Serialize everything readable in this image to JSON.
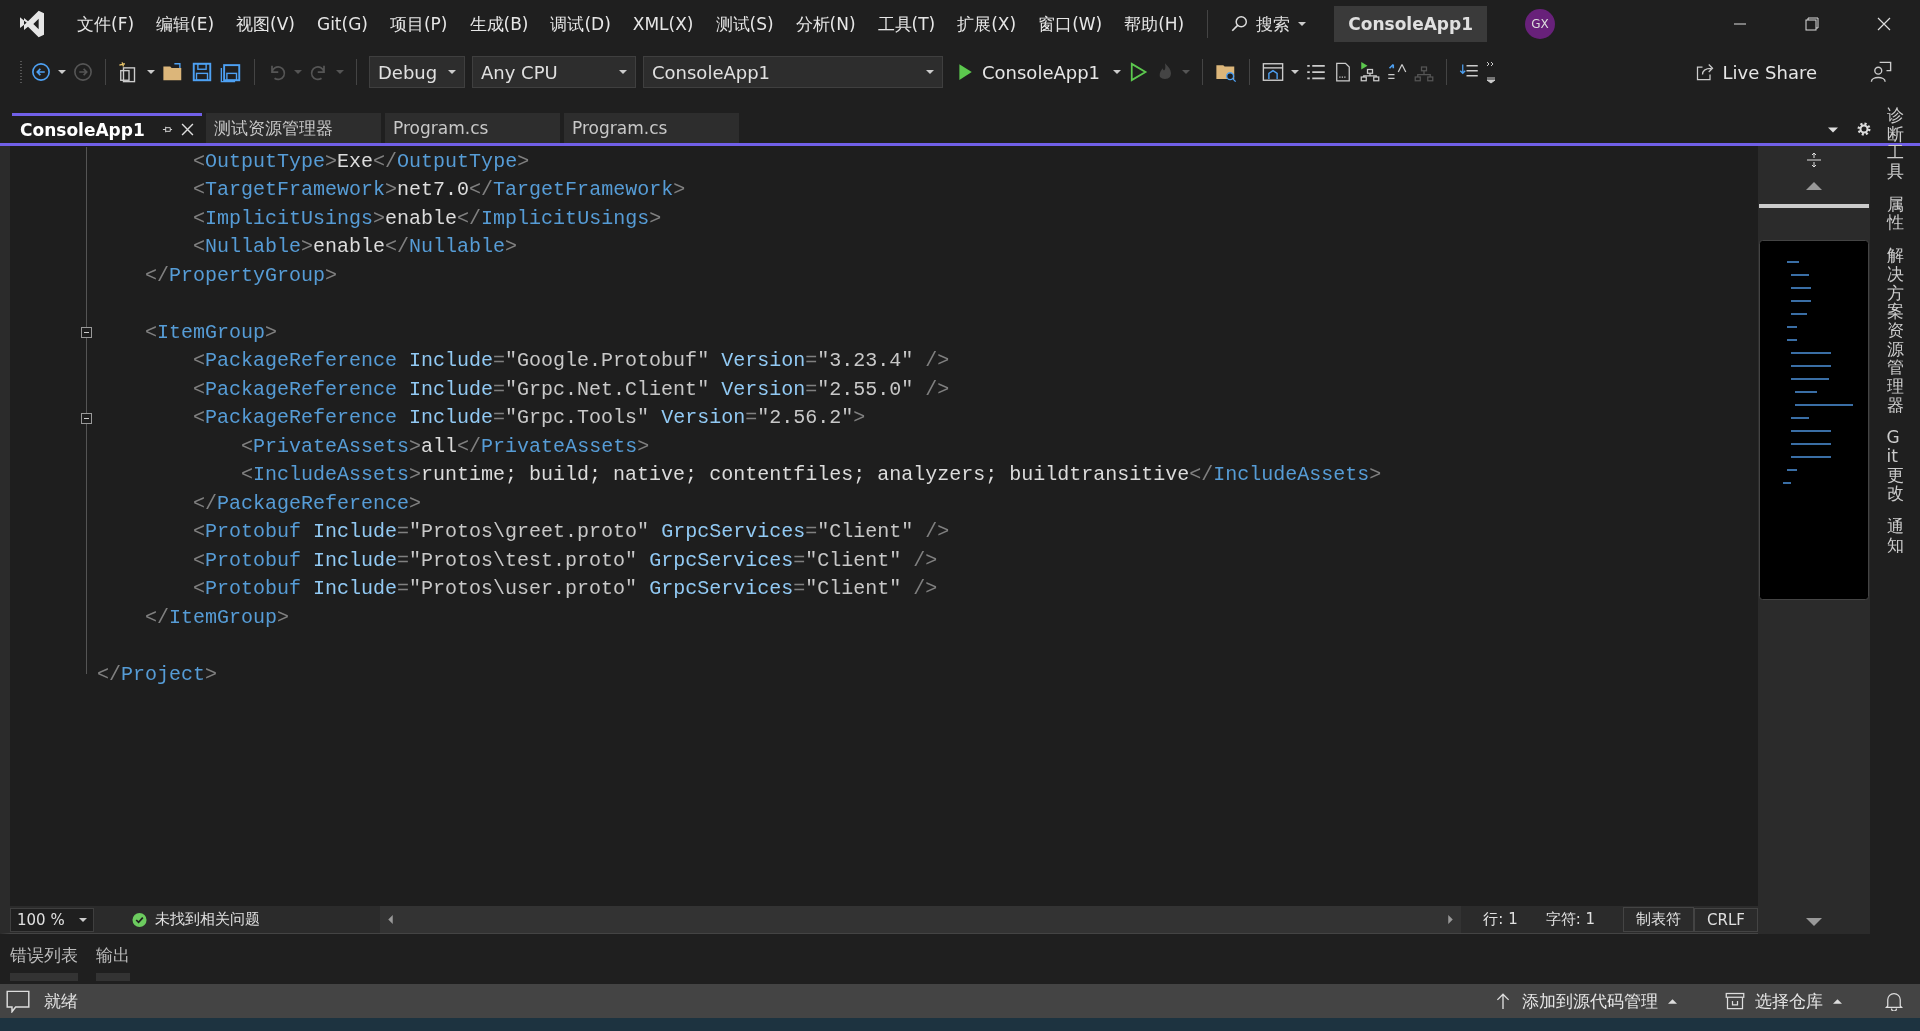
{
  "menu": [
    "文件(F)",
    "编辑(E)",
    "视图(V)",
    "Git(G)",
    "项目(P)",
    "生成(B)",
    "调试(D)",
    "XML(X)",
    "测试(S)",
    "分析(N)",
    "工具(T)",
    "扩展(X)",
    "窗口(W)",
    "帮助(H)"
  ],
  "search": {
    "label": "搜索"
  },
  "window": {
    "title": "ConsoleApp1",
    "avatar": "GX"
  },
  "toolbar": {
    "configuration": "Debug",
    "platform": "Any CPU",
    "project": "ConsoleApp1",
    "run_target": "ConsoleApp1",
    "live_share": "Live Share"
  },
  "tabs": [
    {
      "label": "ConsoleApp1",
      "selected": true
    },
    {
      "label": "测试资源管理器",
      "selected": false
    },
    {
      "label": "Program.cs",
      "selected": false
    },
    {
      "label": "Program.cs",
      "selected": false
    }
  ],
  "code_lines": [
    {
      "kind": "code",
      "collapsible": false,
      "tokens": [
        {
          "kind": "delim",
          "text": "        <"
        },
        {
          "kind": "name",
          "text": "OutputType"
        },
        {
          "kind": "delim",
          "text": ">"
        },
        {
          "kind": "text",
          "text": "Exe"
        },
        {
          "kind": "delim",
          "text": "</"
        },
        {
          "kind": "name",
          "text": "OutputType"
        },
        {
          "kind": "delim",
          "text": ">"
        }
      ]
    },
    {
      "kind": "code",
      "collapsible": false,
      "tokens": [
        {
          "kind": "delim",
          "text": "        <"
        },
        {
          "kind": "name",
          "text": "TargetFramework"
        },
        {
          "kind": "delim",
          "text": ">"
        },
        {
          "kind": "text",
          "text": "net7.0"
        },
        {
          "kind": "delim",
          "text": "</"
        },
        {
          "kind": "name",
          "text": "TargetFramework"
        },
        {
          "kind": "delim",
          "text": ">"
        }
      ]
    },
    {
      "kind": "code",
      "collapsible": false,
      "tokens": [
        {
          "kind": "delim",
          "text": "        <"
        },
        {
          "kind": "name",
          "text": "ImplicitUsings"
        },
        {
          "kind": "delim",
          "text": ">"
        },
        {
          "kind": "text",
          "text": "enable"
        },
        {
          "kind": "delim",
          "text": "</"
        },
        {
          "kind": "name",
          "text": "ImplicitUsings"
        },
        {
          "kind": "delim",
          "text": ">"
        }
      ]
    },
    {
      "kind": "code",
      "collapsible": false,
      "tokens": [
        {
          "kind": "delim",
          "text": "        <"
        },
        {
          "kind": "name",
          "text": "Nullable"
        },
        {
          "kind": "delim",
          "text": ">"
        },
        {
          "kind": "text",
          "text": "enable"
        },
        {
          "kind": "delim",
          "text": "</"
        },
        {
          "kind": "name",
          "text": "Nullable"
        },
        {
          "kind": "delim",
          "text": ">"
        }
      ]
    },
    {
      "kind": "code",
      "collapsible": false,
      "tokens": [
        {
          "kind": "delim",
          "text": "    </"
        },
        {
          "kind": "name",
          "text": "PropertyGroup"
        },
        {
          "kind": "delim",
          "text": ">"
        }
      ]
    },
    {
      "kind": "blank",
      "collapsible": false
    },
    {
      "kind": "code",
      "collapsible": true,
      "tokens": [
        {
          "kind": "delim",
          "text": "    <"
        },
        {
          "kind": "name",
          "text": "ItemGroup"
        },
        {
          "kind": "delim",
          "text": ">"
        }
      ]
    },
    {
      "kind": "code",
      "collapsible": false,
      "tokens": [
        {
          "kind": "delim",
          "text": "        <"
        },
        {
          "kind": "name",
          "text": "PackageReference"
        },
        {
          "kind": "attr",
          "text": " Include"
        },
        {
          "kind": "delim",
          "text": "="
        },
        {
          "kind": "value",
          "text": "\"Google.Protobuf\""
        },
        {
          "kind": "attr",
          "text": " Version"
        },
        {
          "kind": "delim",
          "text": "="
        },
        {
          "kind": "value",
          "text": "\"3.23.4\""
        },
        {
          "kind": "delim",
          "text": " />"
        }
      ]
    },
    {
      "kind": "code",
      "collapsible": false,
      "tokens": [
        {
          "kind": "delim",
          "text": "        <"
        },
        {
          "kind": "name",
          "text": "PackageReference"
        },
        {
          "kind": "attr",
          "text": " Include"
        },
        {
          "kind": "delim",
          "text": "="
        },
        {
          "kind": "value",
          "text": "\"Grpc.Net.Client\""
        },
        {
          "kind": "attr",
          "text": " Version"
        },
        {
          "kind": "delim",
          "text": "="
        },
        {
          "kind": "value",
          "text": "\"2.55.0\""
        },
        {
          "kind": "delim",
          "text": " />"
        }
      ]
    },
    {
      "kind": "code",
      "collapsible": true,
      "tokens": [
        {
          "kind": "delim",
          "text": "        <"
        },
        {
          "kind": "name",
          "text": "PackageReference"
        },
        {
          "kind": "attr",
          "text": " Include"
        },
        {
          "kind": "delim",
          "text": "="
        },
        {
          "kind": "value",
          "text": "\"Grpc.Tools\""
        },
        {
          "kind": "attr",
          "text": " Version"
        },
        {
          "kind": "delim",
          "text": "="
        },
        {
          "kind": "value",
          "text": "\"2.56.2\""
        },
        {
          "kind": "delim",
          "text": ">"
        }
      ]
    },
    {
      "kind": "code",
      "collapsible": false,
      "tokens": [
        {
          "kind": "delim",
          "text": "            <"
        },
        {
          "kind": "name",
          "text": "PrivateAssets"
        },
        {
          "kind": "delim",
          "text": ">"
        },
        {
          "kind": "text",
          "text": "all"
        },
        {
          "kind": "delim",
          "text": "</"
        },
        {
          "kind": "name",
          "text": "PrivateAssets"
        },
        {
          "kind": "delim",
          "text": ">"
        }
      ]
    },
    {
      "kind": "code",
      "collapsible": false,
      "tokens": [
        {
          "kind": "delim",
          "text": "            <"
        },
        {
          "kind": "name",
          "text": "IncludeAssets"
        },
        {
          "kind": "delim",
          "text": ">"
        },
        {
          "kind": "text",
          "text": "runtime; build; native; contentfiles; analyzers; buildtransitive"
        },
        {
          "kind": "delim",
          "text": "</"
        },
        {
          "kind": "name",
          "text": "IncludeAssets"
        },
        {
          "kind": "delim",
          "text": ">"
        }
      ]
    },
    {
      "kind": "code",
      "collapsible": false,
      "tokens": [
        {
          "kind": "delim",
          "text": "        </"
        },
        {
          "kind": "name",
          "text": "PackageReference"
        },
        {
          "kind": "delim",
          "text": ">"
        }
      ]
    },
    {
      "kind": "code",
      "collapsible": false,
      "tokens": [
        {
          "kind": "delim",
          "text": "        <"
        },
        {
          "kind": "name",
          "text": "Protobuf"
        },
        {
          "kind": "attr",
          "text": " Include"
        },
        {
          "kind": "delim",
          "text": "="
        },
        {
          "kind": "value",
          "text": "\"Protos\\greet.proto\""
        },
        {
          "kind": "attr",
          "text": " GrpcServices"
        },
        {
          "kind": "delim",
          "text": "="
        },
        {
          "kind": "value",
          "text": "\"Client\""
        },
        {
          "kind": "delim",
          "text": " />"
        }
      ]
    },
    {
      "kind": "code",
      "collapsible": false,
      "tokens": [
        {
          "kind": "delim",
          "text": "        <"
        },
        {
          "kind": "name",
          "text": "Protobuf"
        },
        {
          "kind": "attr",
          "text": " Include"
        },
        {
          "kind": "delim",
          "text": "="
        },
        {
          "kind": "value",
          "text": "\"Protos\\test.proto\""
        },
        {
          "kind": "attr",
          "text": " GrpcServices"
        },
        {
          "kind": "delim",
          "text": "="
        },
        {
          "kind": "value",
          "text": "\"Client\""
        },
        {
          "kind": "delim",
          "text": " />"
        }
      ]
    },
    {
      "kind": "code",
      "collapsible": false,
      "tokens": [
        {
          "kind": "delim",
          "text": "        <"
        },
        {
          "kind": "name",
          "text": "Protobuf"
        },
        {
          "kind": "attr",
          "text": " Include"
        },
        {
          "kind": "delim",
          "text": "="
        },
        {
          "kind": "value",
          "text": "\"Protos\\user.proto\""
        },
        {
          "kind": "attr",
          "text": " GrpcServices"
        },
        {
          "kind": "delim",
          "text": "="
        },
        {
          "kind": "value",
          "text": "\"Client\""
        },
        {
          "kind": "delim",
          "text": " />"
        }
      ]
    },
    {
      "kind": "code",
      "collapsible": false,
      "tokens": [
        {
          "kind": "delim",
          "text": "    </"
        },
        {
          "kind": "name",
          "text": "ItemGroup"
        },
        {
          "kind": "delim",
          "text": ">"
        }
      ]
    },
    {
      "kind": "blank",
      "collapsible": false
    },
    {
      "kind": "code",
      "collapsible": false,
      "tokens": [
        {
          "kind": "delim",
          "text": "</"
        },
        {
          "kind": "name",
          "text": "Project"
        },
        {
          "kind": "delim",
          "text": ">"
        }
      ]
    }
  ],
  "side_tabs": [
    "诊断工具",
    "属性",
    "解决方案资源管理器",
    "Git 更改",
    "通知"
  ],
  "editor_status": {
    "zoom": "100 %",
    "issues": "未找到相关问题",
    "line": "行: 1",
    "char": "字符: 1",
    "indent": "制表符",
    "line_ending": "CRLF"
  },
  "panel_tabs": [
    "错误列表",
    "输出"
  ],
  "status_bar": {
    "state": "就绪",
    "source_control": "添加到源代码管理",
    "repository": "选择仓库"
  }
}
